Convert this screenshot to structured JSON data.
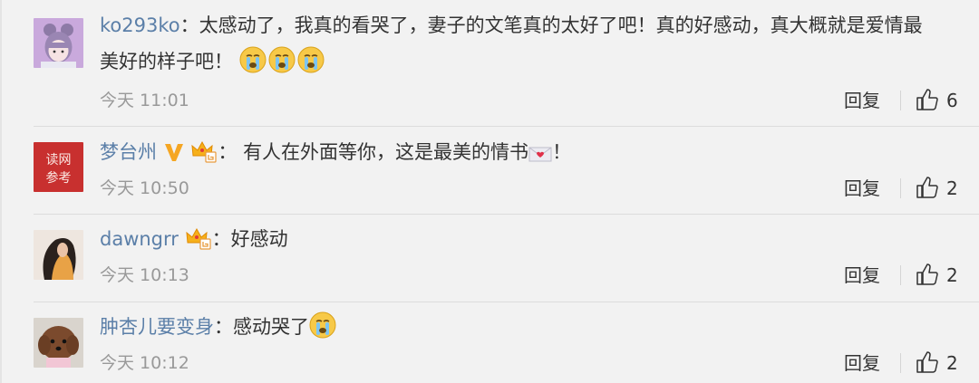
{
  "comments": [
    {
      "username": "ko293ko",
      "text_line1": "太感动了，我真的看哭了，妻子的文笔真的太好了吧！真的好感动，真大概就是爱情最",
      "text_line2": "美好的样子吧！",
      "time": "今天 11:01",
      "reply_label": "回复",
      "likes": "6",
      "avatar_icon": "anime-girl-avatar"
    },
    {
      "username": "梦台州",
      "text": "有人在外面等你，这是最美的情书",
      "text_end": "！",
      "time": "今天 10:50",
      "reply_label": "回复",
      "likes": "2",
      "avatar_icon": "red-seal-avatar",
      "avatar_text": [
        "读网",
        "参考"
      ]
    },
    {
      "username": "dawngrr",
      "text": "好感动",
      "time": "今天 10:13",
      "reply_label": "回复",
      "likes": "2",
      "avatar_icon": "girl-photo-avatar"
    },
    {
      "username": "肿杏儿要变身",
      "text": "感动哭了",
      "time": "今天 10:12",
      "reply_label": "回复",
      "likes": "2",
      "avatar_icon": "puppy-avatar"
    }
  ],
  "colon": "：",
  "colors": {
    "username": "#5b7fa8",
    "text": "#333333",
    "meta": "#999999",
    "background": "#f2f2f2",
    "vip_badge": "#f5a623",
    "seal_red": "#c8302f"
  }
}
